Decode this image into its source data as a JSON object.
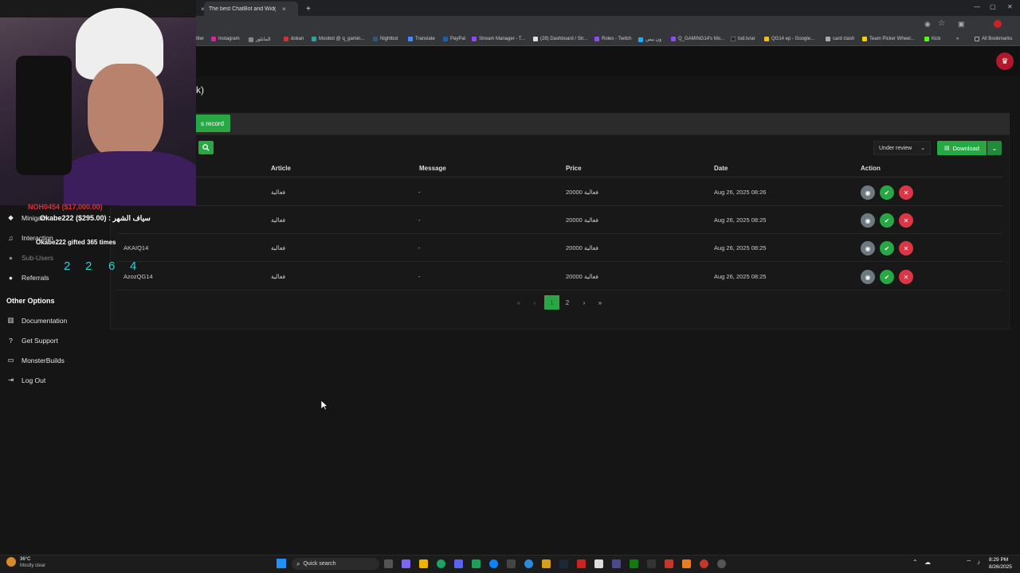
{
  "browser": {
    "tab1_close": "×",
    "tab2_title": "The best ChatBot and Widgets",
    "tab2_close": "×",
    "new_tab": "+",
    "bookmarks": [
      "itter",
      "Instagram",
      "المابلوز",
      "dokan",
      "Moobot @ q_gamin...",
      "Nightbot",
      "Translate",
      "PayPal",
      "Stream Manager - T...",
      "(28) Dashboard / Str...",
      "Roles - Twitch",
      "ون بيس",
      "Q_GAMING14's Mo...",
      "tod.tv/ar",
      "QG14 ep - Google...",
      "card clash",
      "Team Picker Wheel...",
      "Kick"
    ],
    "all_bookmarks": "All Bookmarks",
    "more": "»"
  },
  "page": {
    "title_fragment": "k)",
    "add_record_fragment": "s record",
    "status_select": "Under review",
    "download_label": "Download"
  },
  "table": {
    "headers": [
      "Article",
      "Message",
      "Price",
      "Date",
      "Action"
    ],
    "rows": [
      {
        "user": "",
        "article": "فعالية",
        "message": "-",
        "price": "20000 فعالية",
        "date": "Aug 26, 2025 08:26"
      },
      {
        "user": "",
        "article": "فعالية",
        "message": "-",
        "price": "20000 فعالية",
        "date": "Aug 26, 2025 08:25"
      },
      {
        "user": "AKAIQ14",
        "article": "فعالية",
        "message": "-",
        "price": "20000 فعالية",
        "date": "Aug 26, 2025 08:25"
      },
      {
        "user": "AzozQG14",
        "article": "فعالية",
        "message": "-",
        "price": "20000 فعالية",
        "date": "Aug 26, 2025 08:25"
      }
    ]
  },
  "pagination": {
    "first": "«",
    "prev": "‹",
    "current": "1",
    "page2": "2",
    "next": "›",
    "last": "»"
  },
  "sidebar": {
    "items_partial": [
      "Minigam",
      "Interaction",
      "Sub-Users"
    ],
    "referrals": "Referrals",
    "other_heading": "Other Options",
    "other_items": [
      "Documentation",
      "Get Support",
      "MonsterBuilds",
      "Log Out"
    ]
  },
  "overlay": {
    "line1": "Okabe222 ($295.00) : سياف الشهر",
    "line2": "Okabe222 gifted 365 times",
    "line3": "NOH0454 ($17,000.00)",
    "numbers": [
      "2",
      "2",
      "6",
      "4"
    ]
  },
  "taskbar": {
    "weather_temp": "36°C",
    "weather_desc": "Mostly clear",
    "search": "Quick search",
    "time": "8:29 PM",
    "date": "8/26/2025"
  },
  "colors": {
    "accent": "#28a745",
    "danger": "#dc3545",
    "view": "#6c7a80",
    "brand": "#b3172b"
  }
}
